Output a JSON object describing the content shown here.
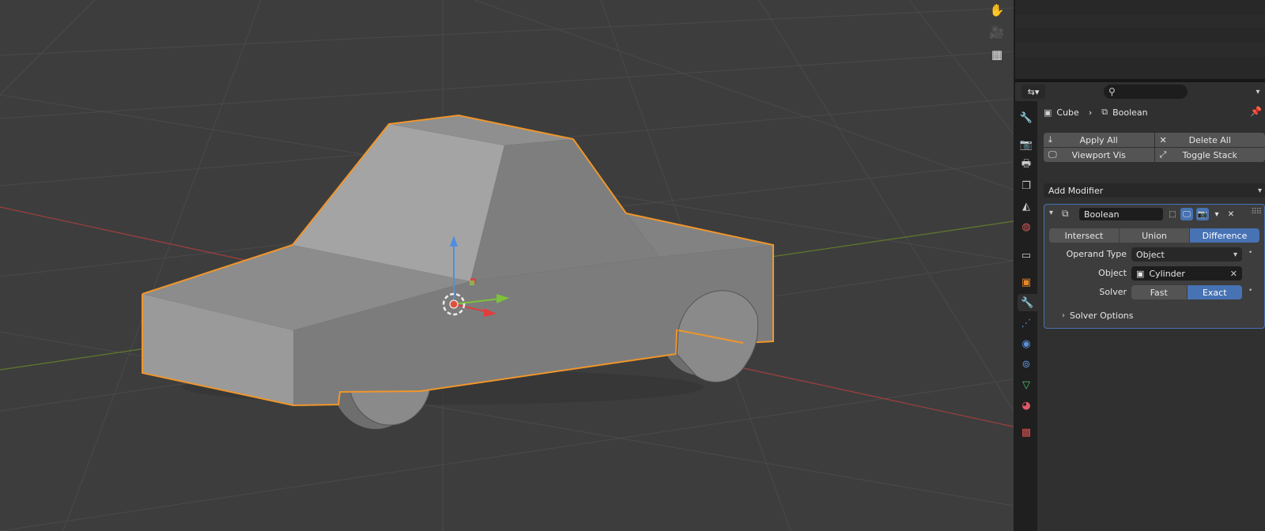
{
  "viewport": {
    "nav_icons": [
      "hand-icon",
      "camera-icon",
      "grid-icon"
    ]
  },
  "properties": {
    "breadcrumb": {
      "object": "Cube",
      "separator": "›",
      "modifier": "Boolean"
    },
    "buttons": {
      "apply_all": "Apply All",
      "delete_all": "Delete All",
      "viewport_vis": "Viewport Vis",
      "toggle_stack": "Toggle Stack"
    },
    "add_modifier": "Add Modifier",
    "modifier": {
      "name": "Boolean",
      "operations": [
        "Intersect",
        "Union",
        "Difference"
      ],
      "active_operation": "Difference",
      "operand_type_label": "Operand Type",
      "operand_type_value": "Object",
      "object_label": "Object",
      "object_value": "Cylinder",
      "solver_label": "Solver",
      "solvers": [
        "Fast",
        "Exact"
      ],
      "active_solver": "Exact",
      "solver_options": "Solver Options"
    }
  },
  "colors": {
    "accent": "#4772b3",
    "selection_outline": "#f0962b",
    "x_axis": "#b34848",
    "y_axis": "#6b8a2e"
  }
}
